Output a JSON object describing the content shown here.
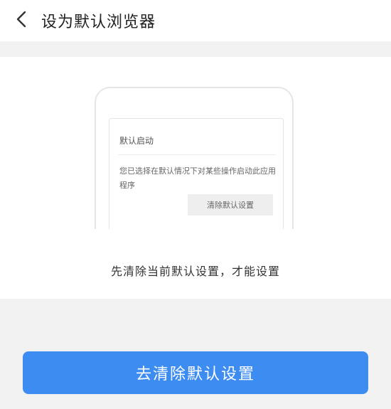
{
  "header": {
    "title": "设为默认浏览器",
    "back_icon": "chevron-left-icon"
  },
  "illustration": {
    "dialog_title": "默认启动",
    "dialog_message": "您已选择在默认情况下对某些操作启动此应用程序",
    "dialog_button": "清除默认设置"
  },
  "hint": "先清除当前默认设置，才能设置",
  "primary_button": {
    "label": "去清除默认设置"
  },
  "colors": {
    "accent": "#3d8cf2",
    "band": "#f2f2f2",
    "text": "#333333"
  }
}
